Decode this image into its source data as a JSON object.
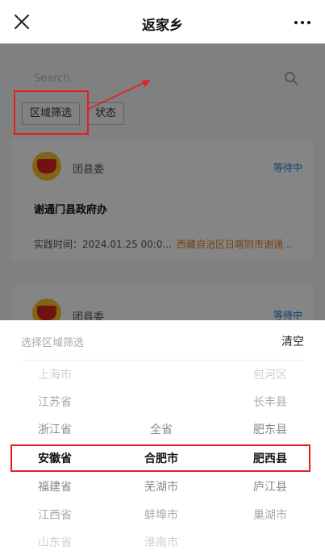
{
  "nav": {
    "title": "返家乡"
  },
  "search": {
    "placeholder": "Search"
  },
  "filters": {
    "region": "区域筛选",
    "status": "状态"
  },
  "cards": [
    {
      "org": "团县委",
      "status": "等待中",
      "title": "谢通门县政府办",
      "time": "实践时间：2024.01.25 00:0...",
      "location": "西藏自治区日喀则市谢通..."
    },
    {
      "org": "团县委",
      "status": "等待中"
    }
  ],
  "picker": {
    "label": "选择区域筛选",
    "clear": "清空",
    "provinces": [
      "上海市",
      "江苏省",
      "浙江省",
      "安徽省",
      "福建省",
      "江西省",
      "山东省"
    ],
    "cities": [
      "全省",
      "合肥市",
      "芜湖市",
      "蚌埠市",
      "淮南市"
    ],
    "counties": [
      "包河区",
      "长丰县",
      "肥东县",
      "肥西县",
      "庐江县",
      "巢湖市"
    ]
  }
}
